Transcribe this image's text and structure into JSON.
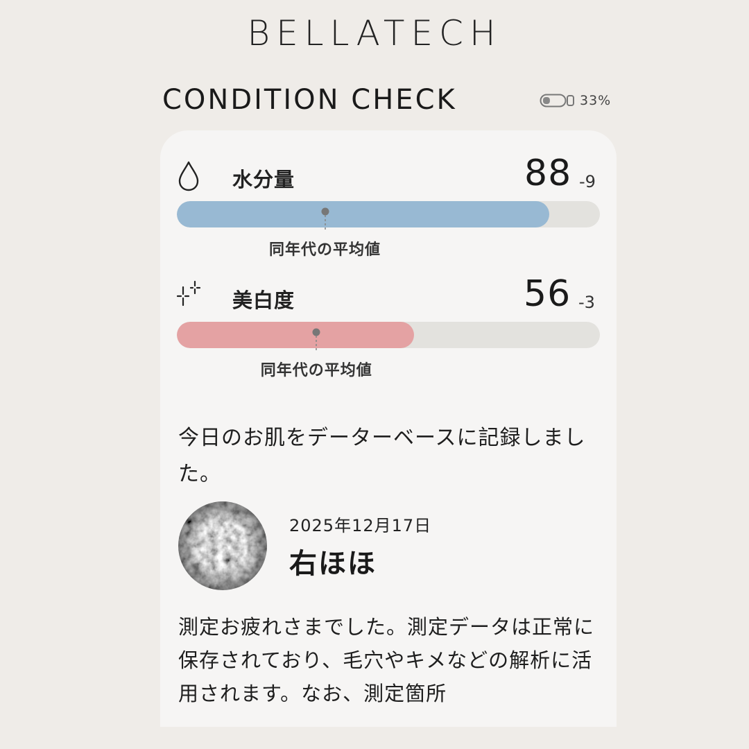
{
  "brand": "BELLATECH",
  "screen_title": "CONDITION CHECK",
  "battery": {
    "icon": "battery-icon",
    "percent_text": "33%",
    "level": 0.33
  },
  "metrics": [
    {
      "icon": "water-drop-icon",
      "label": "水分量",
      "value": "88",
      "delta": "-9",
      "fill_percent": 88,
      "average_percent": 35,
      "color": "#98b9d3",
      "average_label": "同年代の平均値"
    },
    {
      "icon": "sparkle-icon",
      "label": "美白度",
      "value": "56",
      "delta": "-3",
      "fill_percent": 56,
      "average_percent": 33,
      "color": "#e4a2a3",
      "average_label": "同年代の平均値"
    }
  ],
  "record_message": "今日のお肌をデーターベースに記録しました。",
  "record": {
    "date": "2025年12月17日",
    "area": "右ほほ",
    "thumbnail": "skin-texture-image"
  },
  "body_message": "測定お疲れさまでした。測定データは正常に保存されており、毛穴やキメなどの解析に活用されます。なお、測定箇所"
}
